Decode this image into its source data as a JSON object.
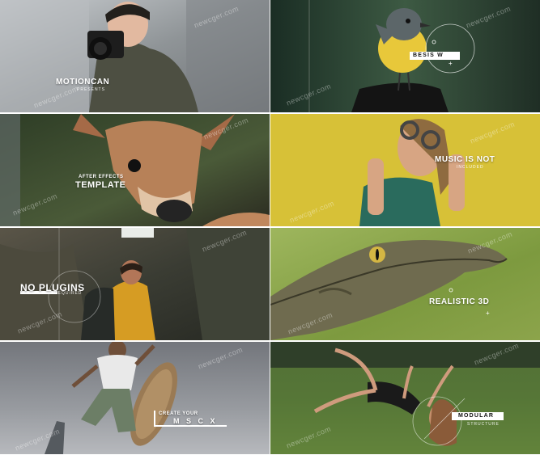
{
  "watermark": "newcger.com",
  "colors": {
    "text": "#ffffff",
    "box": "#ffffff",
    "box_text": "#111111"
  },
  "tiles": [
    {
      "title": "MOTIONCAN",
      "subtitle": "PRESENTS"
    },
    {
      "title": "BESIS W",
      "subtitle": ""
    },
    {
      "title_line1": "AFTER EFFECTS",
      "title_line2": "TEMPLATE"
    },
    {
      "title": "MUSIC IS NOT",
      "subtitle": "INCLUDED"
    },
    {
      "title": "NO PLUGINS",
      "subtitle": "REQUIRED"
    },
    {
      "title": "REALISTIC 3D",
      "subtitle": ""
    },
    {
      "title_line1": "CREATE YOUR",
      "title_line2": "M S C X"
    },
    {
      "title": "MODULAR",
      "subtitle": "STRUCTURE"
    }
  ]
}
